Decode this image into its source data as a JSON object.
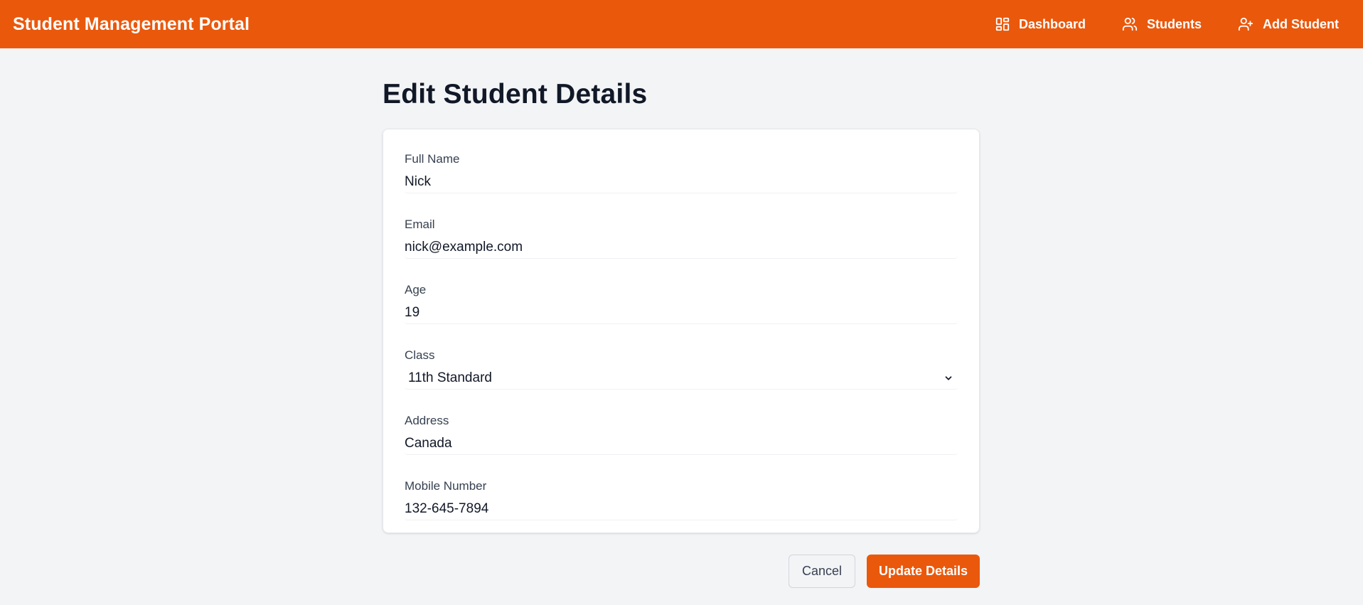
{
  "navbar": {
    "brand": "Student Management Portal",
    "links": [
      {
        "label": "Dashboard",
        "icon": "dashboard-icon"
      },
      {
        "label": "Students",
        "icon": "users-icon"
      },
      {
        "label": "Add Student",
        "icon": "user-plus-icon"
      }
    ],
    "accent_color": "#ea580c"
  },
  "page": {
    "title": "Edit Student Details"
  },
  "form": {
    "full_name": {
      "label": "Full Name",
      "value": "Nick"
    },
    "email": {
      "label": "Email",
      "value": "nick@example.com"
    },
    "age": {
      "label": "Age",
      "value": "19"
    },
    "class": {
      "label": "Class",
      "value": "11th Standard",
      "icon": "chevron-down-icon"
    },
    "address": {
      "label": "Address",
      "value": "Canada"
    },
    "mobile": {
      "label": "Mobile Number",
      "value": "132-645-7894"
    }
  },
  "actions": {
    "cancel_label": "Cancel",
    "update_label": "Update Details"
  }
}
